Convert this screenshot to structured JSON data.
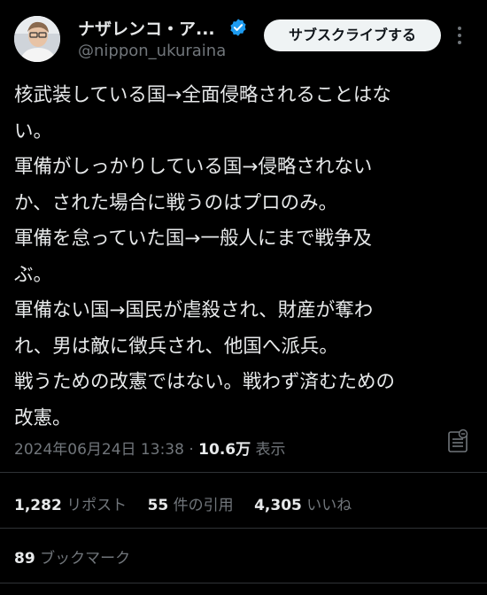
{
  "author": {
    "display_name": "ナザレンコ・ア...",
    "handle": "@nippon_ukuraina",
    "verified_color": "#1d9bf0"
  },
  "subscribe_label": "サブスクライブする",
  "tweet_lines": [
    "核武装している国→全面侵略されることはな",
    "い。",
    "軍備がしっかりしている国→侵略されない",
    "か、された場合に戦うのはプロのみ。",
    "軍備を怠っていた国→一般人にまで戦争及",
    "ぶ。",
    "軍備ない国→国民が虐殺され、財産が奪わ",
    "れ、男は敵に徴兵され、他国へ派兵。",
    "戦うための改憲ではない。戦わず済むための",
    "改憲。"
  ],
  "meta": {
    "timestamp": "2024年06月24日 13:38",
    "separator": "·",
    "views_count": "10.6万",
    "views_label": "表示"
  },
  "stats": {
    "reposts_count": "1,282",
    "reposts_label": "リポスト",
    "quotes_count": "55",
    "quotes_label": "件の引用",
    "likes_count": "4,305",
    "likes_label": "いいね"
  },
  "bookmarks": {
    "count": "89",
    "label": "ブックマーク"
  }
}
